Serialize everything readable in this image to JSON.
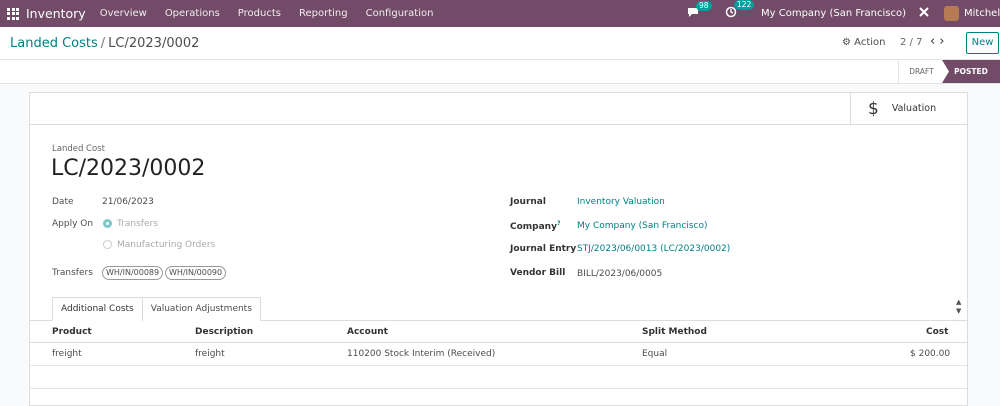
{
  "navbar": {
    "app_title": "Inventory",
    "menu": [
      "Overview",
      "Operations",
      "Products",
      "Reporting",
      "Configuration"
    ],
    "messages_count": "98",
    "activities_count": "122",
    "company": "My Company (San Francisco)",
    "user": "Mitchell Admin",
    "brand_color": "#714b67"
  },
  "breadcrumb": {
    "parent": "Landed Costs",
    "separator": "/",
    "current": "LC/2023/0002"
  },
  "controls": {
    "action_label": "Action",
    "pager": "2 / 7",
    "new_label": "New"
  },
  "status": {
    "draft": "DRAFT",
    "posted": "POSTED"
  },
  "smart_button": {
    "valuation_label": "Valuation",
    "icon": "dollar-icon"
  },
  "document": {
    "label": "Landed Cost",
    "name": "LC/2023/0002"
  },
  "fields": {
    "date_label": "Date",
    "date_value": "21/06/2023",
    "apply_on_label": "Apply On",
    "apply_on_options": [
      "Transfers",
      "Manufacturing Orders"
    ],
    "apply_on_selected": "Transfers",
    "transfers_label": "Transfers",
    "transfers": [
      "WH/IN/00089",
      "WH/IN/00090"
    ],
    "journal_label": "Journal",
    "journal_value": "Inventory Valuation",
    "company_label": "Company",
    "company_help": "?",
    "company_value": "My Company (San Francisco)",
    "journal_entry_label": "Journal Entry",
    "journal_entry_value": "STJ/2023/06/0013 (LC/2023/0002)",
    "vendor_bill_label": "Vendor Bill",
    "vendor_bill_value": "BILL/2023/06/0005"
  },
  "tabs": [
    "Additional Costs",
    "Valuation Adjustments"
  ],
  "table": {
    "columns": [
      "Product",
      "Description",
      "Account",
      "Split Method",
      "Cost"
    ],
    "rows": [
      {
        "product": "freight",
        "description": "freight",
        "account": "110200 Stock Interim (Received)",
        "split_method": "Equal",
        "cost": "$ 200.00"
      }
    ]
  }
}
